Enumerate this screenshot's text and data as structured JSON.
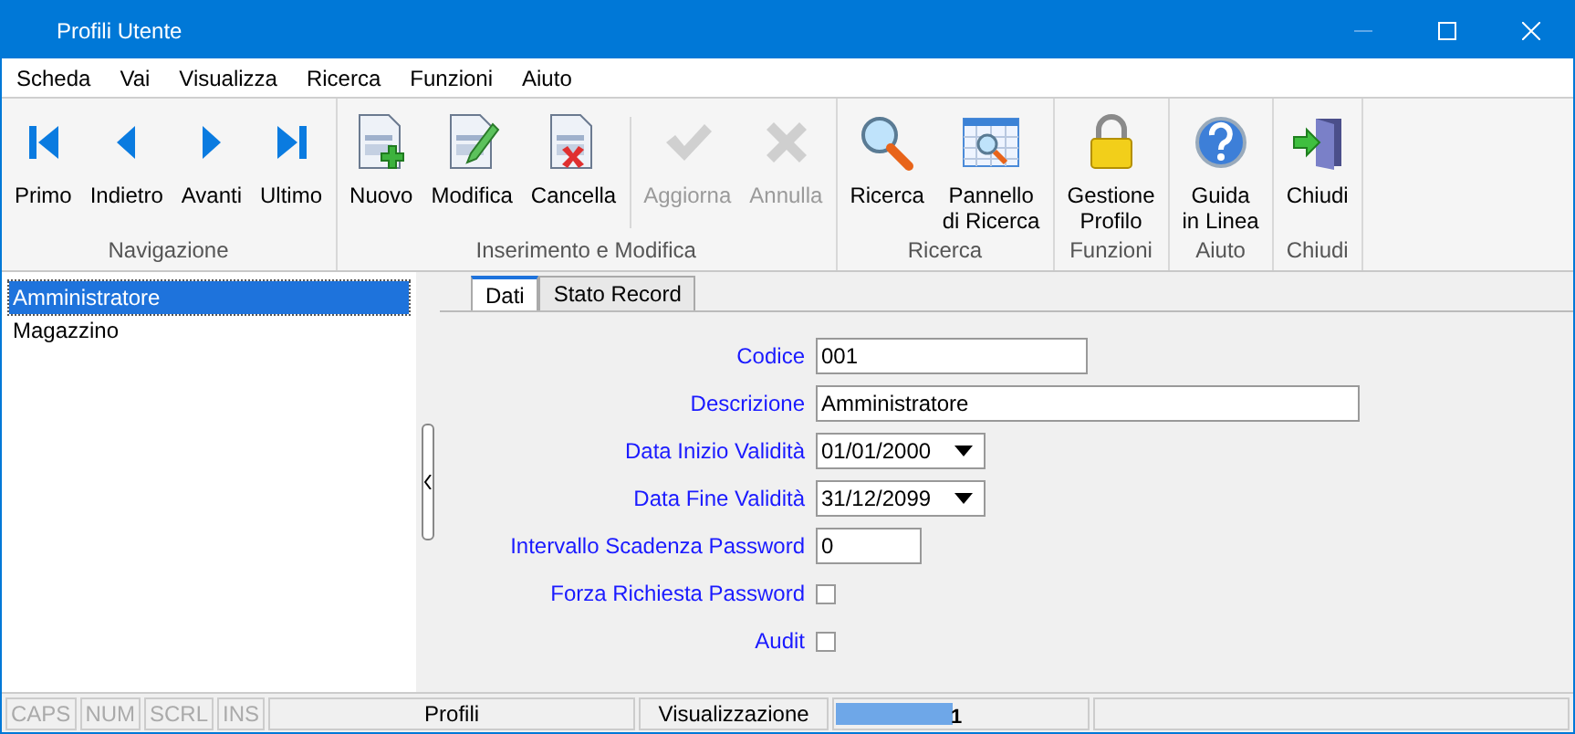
{
  "window": {
    "title": "Profili Utente"
  },
  "menu": [
    "Scheda",
    "Vai",
    "Visualizza",
    "Ricerca",
    "Funzioni",
    "Aiuto"
  ],
  "toolbar": [
    {
      "group": "Navigazione",
      "buttons": [
        {
          "kind": "first",
          "label": "Primo",
          "disabled": false
        },
        {
          "kind": "prev",
          "label": "Indietro",
          "disabled": false
        },
        {
          "kind": "next",
          "label": "Avanti",
          "disabled": false
        },
        {
          "kind": "last",
          "label": "Ultimo",
          "disabled": false
        }
      ]
    },
    {
      "group": "Inserimento e Modifica",
      "buttons": [
        {
          "kind": "new",
          "label": "Nuovo",
          "disabled": false
        },
        {
          "kind": "edit",
          "label": "Modifica",
          "disabled": false
        },
        {
          "kind": "delete",
          "label": "Cancella",
          "disabled": false
        },
        {
          "kind": "save",
          "label": "Aggiorna",
          "disabled": true
        },
        {
          "kind": "cancel",
          "label": "Annulla",
          "disabled": true
        }
      ]
    },
    {
      "group": "Ricerca",
      "buttons": [
        {
          "kind": "search",
          "label": "Ricerca",
          "disabled": false
        },
        {
          "kind": "panel",
          "label": "Pannello\ndi Ricerca",
          "disabled": false
        }
      ]
    },
    {
      "group": "Funzioni",
      "buttons": [
        {
          "kind": "lock",
          "label": "Gestione\nProfilo",
          "disabled": false
        }
      ]
    },
    {
      "group": "Aiuto",
      "buttons": [
        {
          "kind": "help",
          "label": "Guida\nin Linea",
          "disabled": false
        }
      ]
    },
    {
      "group": "Chiudi",
      "buttons": [
        {
          "kind": "exit",
          "label": "Chiudi",
          "disabled": false
        }
      ]
    }
  ],
  "list": [
    {
      "label": "Amministratore",
      "selected": true
    },
    {
      "label": "Magazzino",
      "selected": false
    }
  ],
  "tabs": [
    {
      "label": "Dati",
      "selected": true
    },
    {
      "label": "Stato Record",
      "selected": false
    }
  ],
  "fields": [
    {
      "kind": "text",
      "label": "Codice",
      "value": "001"
    },
    {
      "kind": "text",
      "label": "Descrizione",
      "value": "Amministratore"
    },
    {
      "kind": "date",
      "label": "Data Inizio Validità",
      "value": "01/01/2000"
    },
    {
      "kind": "date",
      "label": "Data Fine Validità",
      "value": "31/12/2099"
    },
    {
      "kind": "text",
      "label": "Intervallo Scadenza Password",
      "value": "0"
    },
    {
      "kind": "checkbox",
      "label": "Forza Richiesta Password",
      "checked": false
    },
    {
      "kind": "checkbox",
      "label": "Audit",
      "checked": false
    }
  ],
  "status_bar": {
    "indicators": [
      {
        "label": "CAPS",
        "disabled": true
      },
      {
        "label": "NUM",
        "disabled": true
      },
      {
        "label": "SCRL",
        "disabled": true
      },
      {
        "label": "INS",
        "disabled": true
      }
    ],
    "panels": [
      "Profili",
      "Visualizzazione"
    ],
    "progress": {
      "level": 0.47,
      "reading": "1"
    }
  }
}
